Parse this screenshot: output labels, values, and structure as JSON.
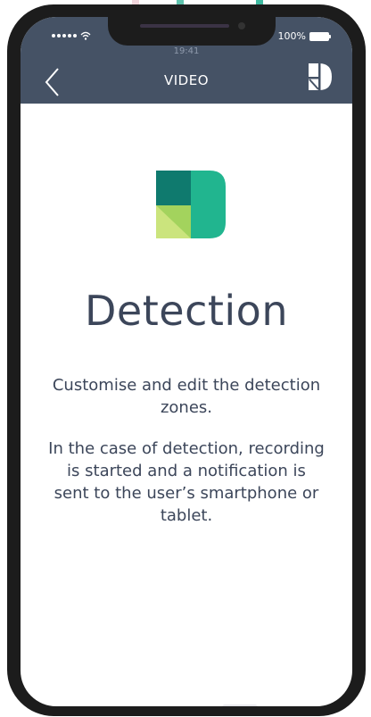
{
  "status_bar": {
    "battery": "100%",
    "time": "19:41"
  },
  "nav": {
    "title": "VIDEO"
  },
  "content": {
    "title": "Detection",
    "paragraph1": "Customise and edit the detection zones.",
    "paragraph2": "In the case of detection, recording is started and a notification is sent to the user’s smartphone or tablet."
  },
  "colors": {
    "header_bg": "#455265",
    "text": "#3c465a",
    "logo_dark": "#0f7a6e",
    "logo_green": "#21b58f",
    "logo_lime": "#a3d35d",
    "logo_light": "#cbe47d"
  }
}
